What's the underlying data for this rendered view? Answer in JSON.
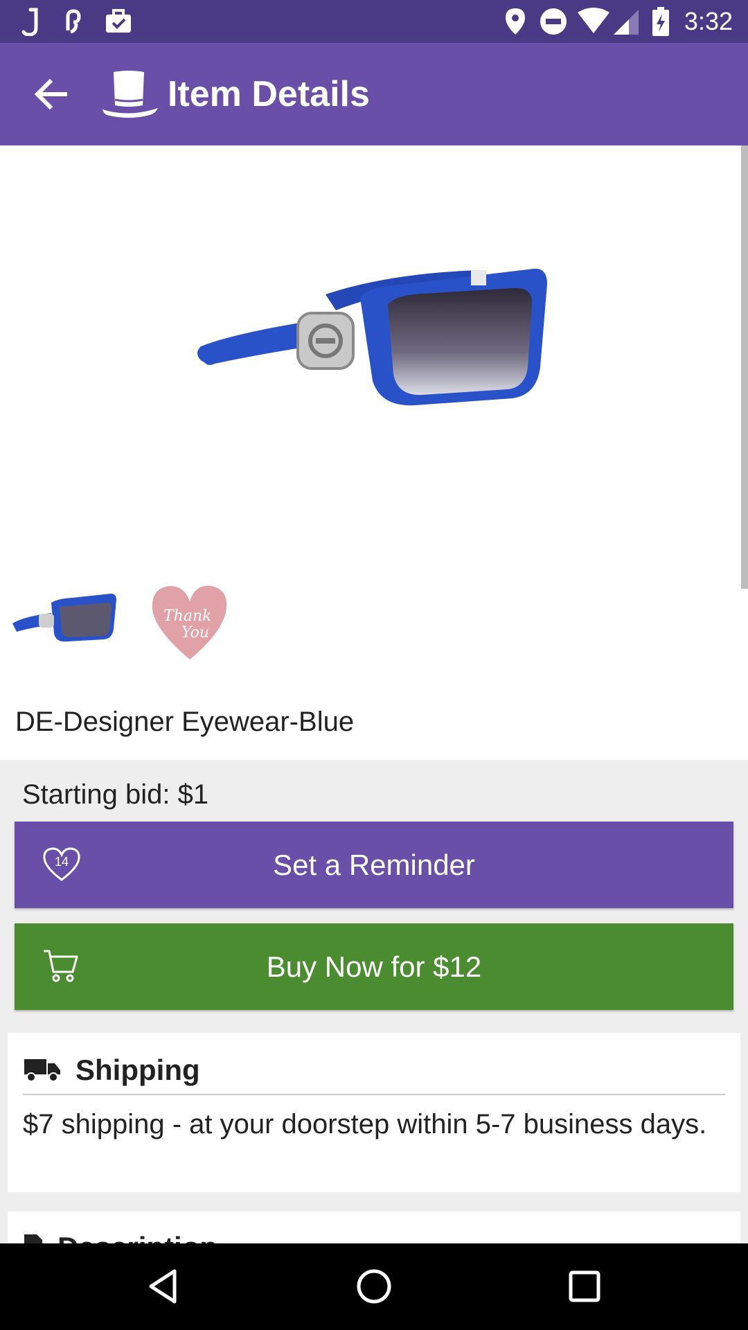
{
  "status_bar": {
    "time": "3:32",
    "left_icons": [
      "j-app-icon",
      "link-icon",
      "briefcase-check-icon"
    ],
    "right_icons": [
      "location-icon",
      "do-not-disturb-icon",
      "wifi-icon",
      "signal-icon",
      "battery-charging-icon"
    ]
  },
  "app_bar": {
    "back_icon": "arrow-back-icon",
    "logo_icon": "top-hat-icon",
    "title": "Item Details"
  },
  "item": {
    "title": "DE-Designer Eyewear-Blue",
    "thumbnails": [
      {
        "name": "sunglasses-thumbnail",
        "alt": ""
      },
      {
        "name": "thank-you-heart-thumbnail",
        "text_line1": "Thank",
        "text_line2": "You"
      }
    ]
  },
  "bid": {
    "starting_bid": "Starting bid: $1"
  },
  "buttons": {
    "reminder_label": "Set a Reminder",
    "reminder_count": "14",
    "buy_label": "Buy Now for $12"
  },
  "shipping": {
    "header": "Shipping",
    "text": "$7 shipping - at your doorstep within 5-7 business days."
  },
  "description": {
    "header": "Description"
  },
  "colors": {
    "status_bar": "#4a3a85",
    "app_bar": "#6a4fa8",
    "reminder_button": "#6a4fa8",
    "buy_button": "#4a8c2f",
    "frame_blue": "#2a52c8",
    "heart_pink": "#e0a2a6"
  }
}
